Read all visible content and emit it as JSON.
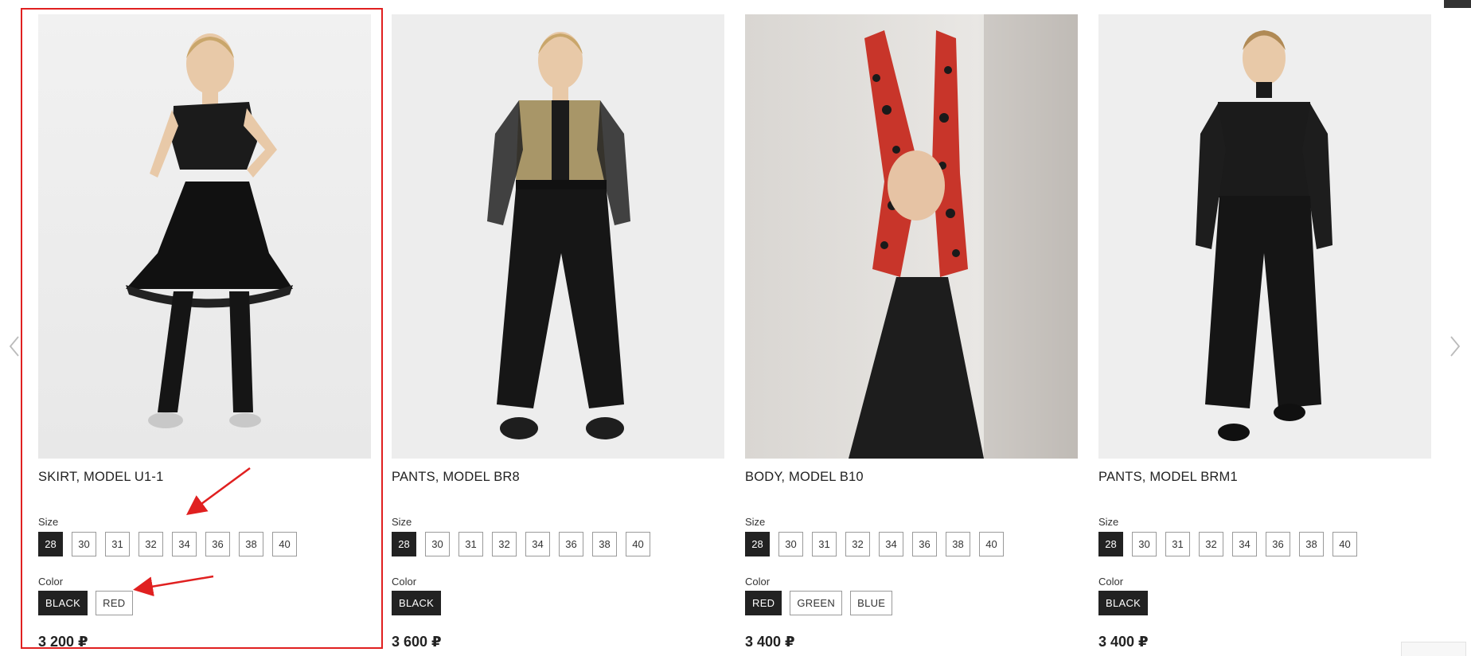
{
  "products": [
    {
      "name": "SKIRT, MODEL U1-1",
      "size_label": "Size",
      "sizes": [
        "28",
        "30",
        "31",
        "32",
        "34",
        "36",
        "38",
        "40"
      ],
      "selected_size": "28",
      "color_label": "Color",
      "colors": [
        "BLACK",
        "RED"
      ],
      "selected_color": "BLACK",
      "price": "3 200 ₽"
    },
    {
      "name": "PANTS, MODEL BR8",
      "size_label": "Size",
      "sizes": [
        "28",
        "30",
        "31",
        "32",
        "34",
        "36",
        "38",
        "40"
      ],
      "selected_size": "28",
      "color_label": "Color",
      "colors": [
        "BLACK"
      ],
      "selected_color": "BLACK",
      "price": "3 600 ₽"
    },
    {
      "name": "BODY, MODEL B10",
      "size_label": "Size",
      "sizes": [
        "28",
        "30",
        "31",
        "32",
        "34",
        "36",
        "38",
        "40"
      ],
      "selected_size": "28",
      "color_label": "Color",
      "colors": [
        "RED",
        "GREEN",
        "BLUE"
      ],
      "selected_color": "RED",
      "price": "3 400 ₽"
    },
    {
      "name": "PANTS, MODEL BRM1",
      "size_label": "Size",
      "sizes": [
        "28",
        "30",
        "31",
        "32",
        "34",
        "36",
        "38",
        "40"
      ],
      "selected_size": "28",
      "color_label": "Color",
      "colors": [
        "BLACK"
      ],
      "selected_color": "BLACK",
      "price": "3 400 ₽"
    }
  ],
  "icons": {
    "prev": "chevron-left-icon",
    "next": "chevron-right-icon"
  },
  "colors": {
    "selected_chip": "#222222",
    "highlight": "#e02020",
    "arrow": "#e02020"
  }
}
